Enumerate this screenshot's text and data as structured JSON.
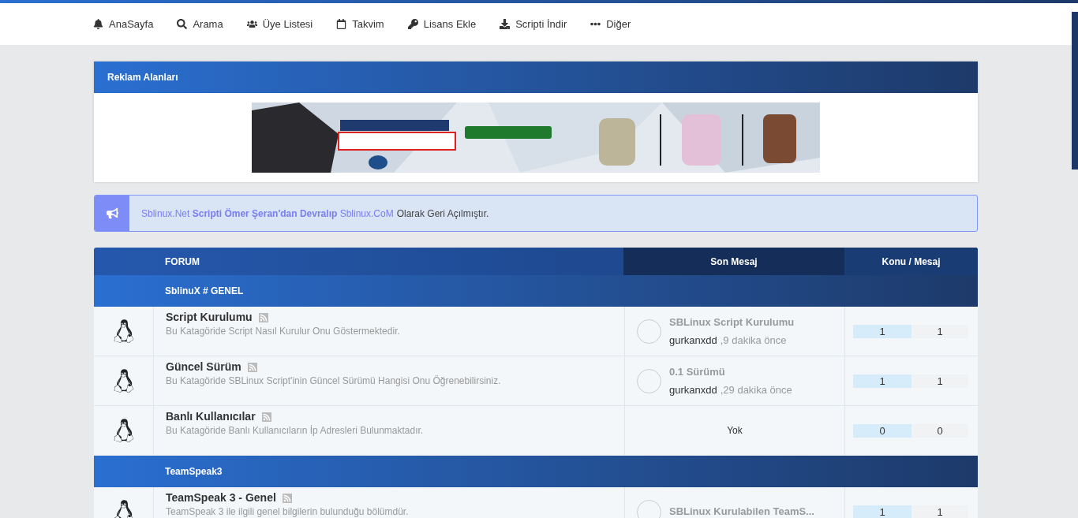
{
  "nav": [
    {
      "label": "AnaSayfa"
    },
    {
      "label": "Arama"
    },
    {
      "label": "Üye Listesi"
    },
    {
      "label": "Takvim"
    },
    {
      "label": "Lisans Ekle"
    },
    {
      "label": "Scripti İndir"
    },
    {
      "label": "Diğer"
    }
  ],
  "ad_panel": {
    "title": "Reklam Alanları"
  },
  "announcement": {
    "text": "Sblinux.Net **Scripti Ömer Şeran'dan Devralıp** Sblinux.CoM",
    "suffix": "Olarak Geri Açılmıştır."
  },
  "table": {
    "columns": [
      "FORUM",
      "Son Mesaj",
      "Konu / Mesaj"
    ],
    "categories": [
      {
        "title": "SblinuX # GENEL",
        "forums": [
          {
            "name": "Script Kurulumu",
            "description": "Bu Katagöride Script Nasıl Kurulur Onu Göstermektedir.",
            "last_post": {
              "title": "SBLinux Script Kurulumu",
              "user": "gurkanxdd",
              "time": ",9 dakika önce"
            },
            "topics": "1",
            "posts": "1"
          },
          {
            "name": "Güncel Sürüm",
            "description": "Bu Katagöride SBLinux Script'inin Güncel Sürümü Hangisi Onu Öğrenebilirsiniz.",
            "last_post": {
              "title": "0.1 Sürümü",
              "user": "gurkanxdd",
              "time": ",29 dakika önce"
            },
            "topics": "1",
            "posts": "1"
          },
          {
            "name": "Banlı Kullanıcılar",
            "description": "Bu Katagöride Banlı Kullanıcıların İp Adresleri Bulunmaktadır.",
            "empty_text": "Yok",
            "topics": "0",
            "posts": "0"
          }
        ]
      },
      {
        "title": "TeamSpeak3",
        "forums": [
          {
            "name": "TeamSpeak 3 - Genel",
            "description": "TeamSpeak 3 ile ilgili genel bilgilerin bulunduğu bölümdür.",
            "last_post": {
              "title": "SBLinux Kurulabilen TeamS..."
            },
            "topics": "1",
            "posts": "1"
          }
        ]
      }
    ]
  }
}
